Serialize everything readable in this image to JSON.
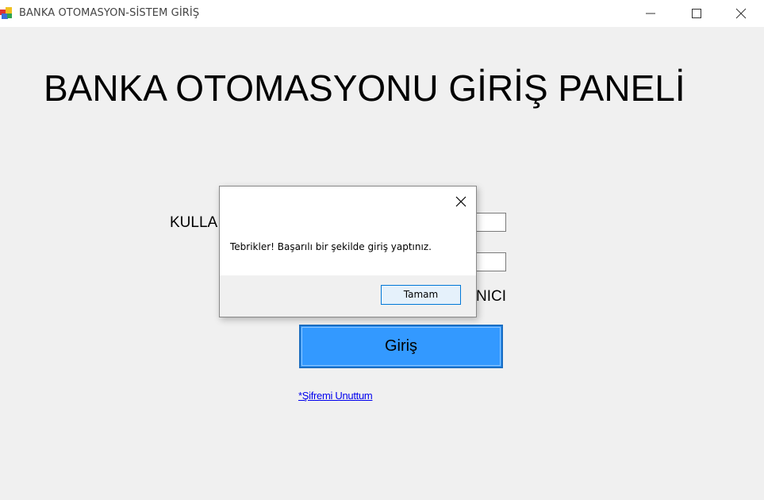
{
  "window": {
    "title": "BANKA OTOMASYON-SİSTEM GİRİŞ",
    "controls": [
      "minimize-icon",
      "maximize-icon",
      "close-icon"
    ]
  },
  "form": {
    "heading": "BANKA OTOMASYONU GİRİŞ PANELİ",
    "username_label_visible": "KULLA",
    "user_type_label_visible": "NICI",
    "username_value": "",
    "password_value": "",
    "login_button": "Giriş",
    "forgot_link": "*Şifremi Unuttum"
  },
  "dialog": {
    "message": "Tebrikler! Başarılı bir şekilde giriş yaptınız.",
    "ok_button": "Tamam",
    "close_icon": "close-icon"
  },
  "colors": {
    "login_button_bg": "#3399ff",
    "link": "#0000ee",
    "dialog_ok_border": "#0078d7"
  }
}
